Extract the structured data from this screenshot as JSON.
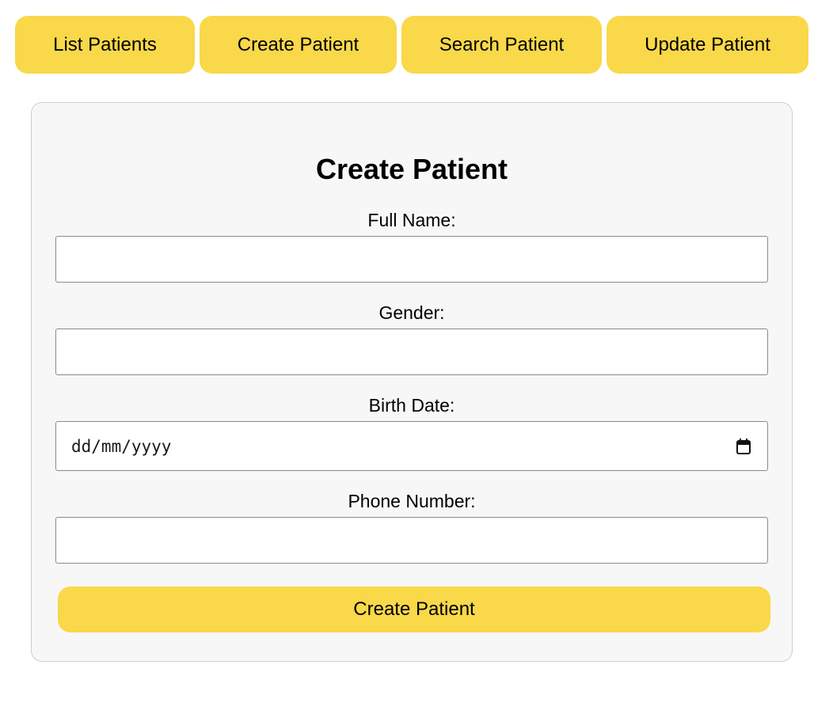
{
  "nav": {
    "buttons": [
      {
        "label": "List Patients"
      },
      {
        "label": "Create Patient"
      },
      {
        "label": "Search Patient"
      },
      {
        "label": "Update Patient"
      }
    ]
  },
  "form": {
    "title": "Create Patient",
    "fields": {
      "full_name": {
        "label": "Full Name:",
        "value": ""
      },
      "gender": {
        "label": "Gender:",
        "value": ""
      },
      "birth_date": {
        "label": "Birth Date:",
        "placeholder": "dd/mm/yyyy",
        "icon": "calendar-icon"
      },
      "phone_number": {
        "label": "Phone Number:",
        "value": ""
      }
    },
    "submit_label": "Create Patient"
  },
  "colors": {
    "accent": "#f9d84a",
    "card_background": "#f7f7f7",
    "card_border": "#cfcfcf",
    "input_border": "#8a8a8a"
  }
}
